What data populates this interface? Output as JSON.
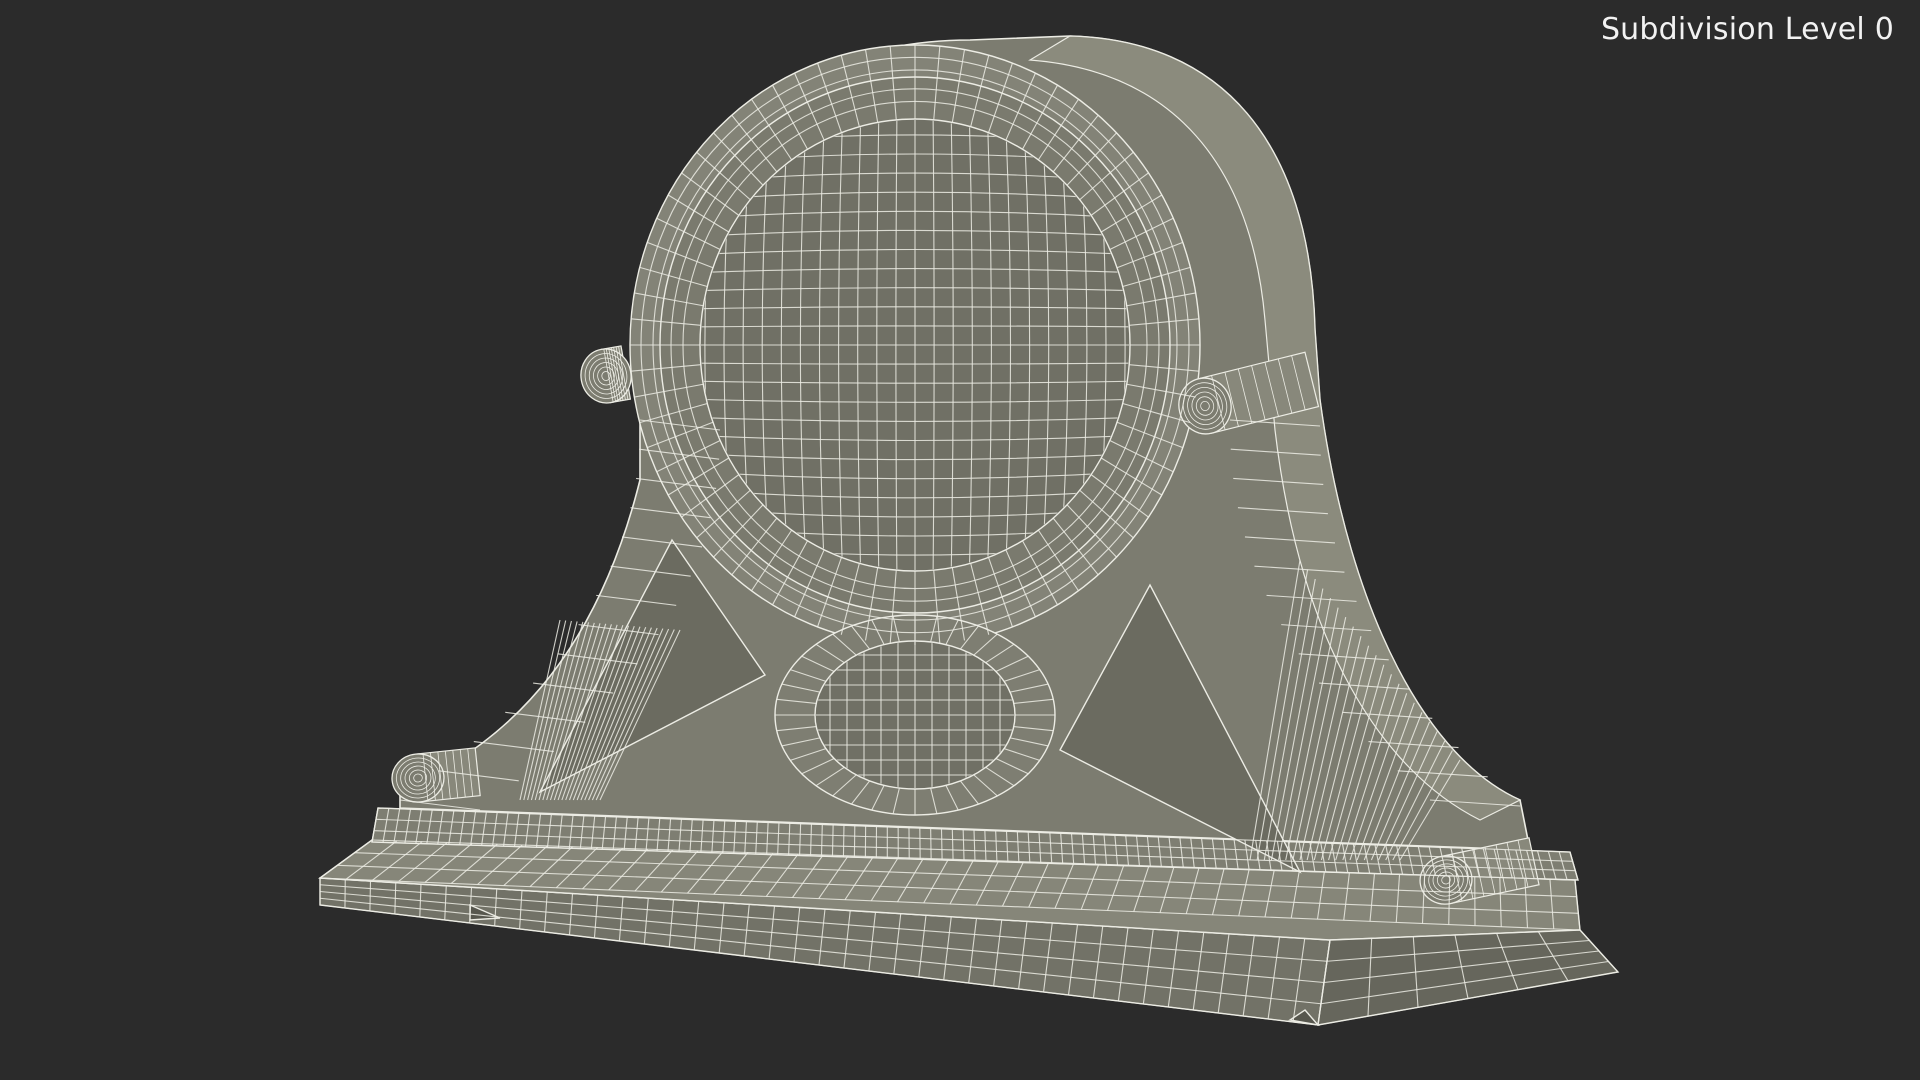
{
  "viewport": {
    "overlay_label": "Subdivision Level 0",
    "background_color": "#2b2b2b",
    "model_fill_color": "#7c7c70",
    "wire_color": "#ecece4"
  }
}
